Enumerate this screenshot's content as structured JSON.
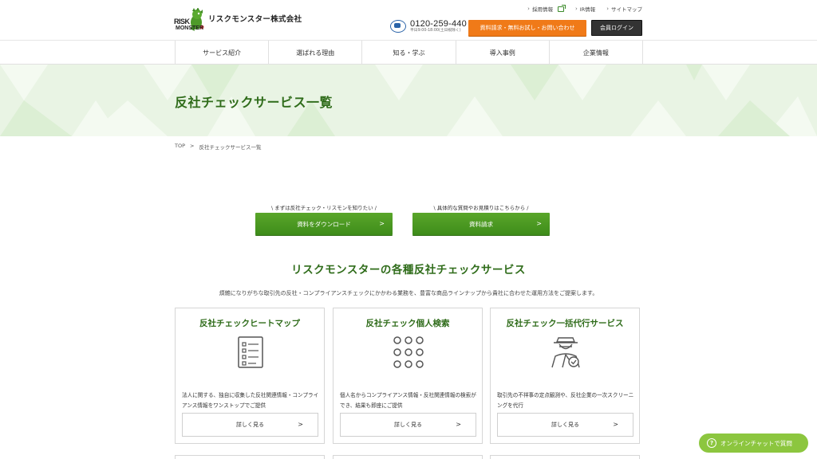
{
  "header": {
    "logo_text_1": "RISK",
    "logo_text_2": "MONSTER",
    "company_name": "リスクモンスター株式会社",
    "top_links": [
      "採用情報",
      "IR情報",
      "サイトマップ"
    ],
    "phone_number": "0120-259-440",
    "phone_hours": "平日9:00-18:00(土日祝除く)",
    "cta_button": "資料請求・無料お試し・お問い合わせ",
    "login_button": "会員ログイン"
  },
  "nav": {
    "items": [
      "サービス紹介",
      "選ばれる理由",
      "知る・学ぶ",
      "導入事例",
      "企業情報"
    ]
  },
  "hero": {
    "title": "反社チェックサービス一覧"
  },
  "breadcrumb": {
    "home": "TOP",
    "separator": ">",
    "current": "反社チェックサービス一覧"
  },
  "cta": {
    "download_caption": "\\ まずは反社チェック・リスモンを知りたい /",
    "download_label": "資料をダウンロード",
    "request_caption": "\\ 具体的な質問やお見積りはこちらから /",
    "request_label": "資料請求",
    "arrow": ">"
  },
  "section": {
    "title": "リスクモンスターの各種反社チェックサービス",
    "lead": "煩雑になりがちな取引先の反社・コンプライアンスチェックにかかわる業務を、豊富な商品ラインナップから貴社に合わせた運用方法をご提案します。"
  },
  "cards": [
    {
      "title": "反社チェックヒートマップ",
      "icon": "checklist-icon",
      "description": "法人に関する、独自に収集した反社関連情報・コンプライアンス情報をワンストップでご提供",
      "more": "詳しく見る"
    },
    {
      "title": "反社チェック個人検索",
      "icon": "dot-grid-icon",
      "description": "個人名からコンプライアンス情報・反社関連情報の検索ができ、結果も即座にご提供",
      "more": "詳しく見る"
    },
    {
      "title": "反社チェック一括代行サービス",
      "icon": "agent-icon",
      "description": "取引先の不祥事の定点観測や、反社企業の一次スクリーニングを代行",
      "more": "詳しく見る"
    }
  ],
  "chat": {
    "label": "オンラインチャットで質問",
    "icon": "question-icon"
  },
  "colors": {
    "brand_green": "#2f6c1a",
    "button_green": "#4a9a22",
    "orange": "#f07a18",
    "chat_green": "#8cc63f"
  }
}
